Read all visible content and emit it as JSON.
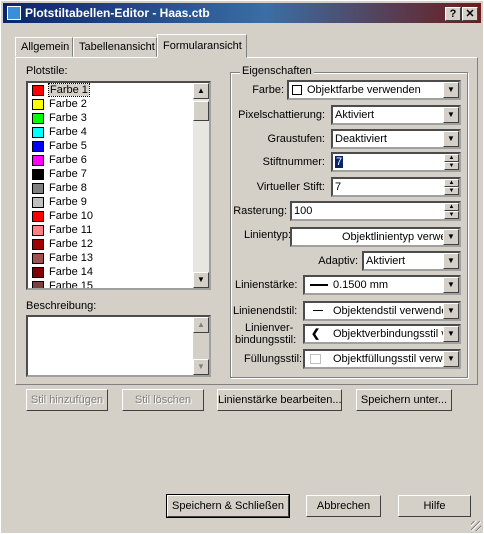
{
  "window": {
    "title": "Plotstiltabellen-Editor - Haas.ctb",
    "help_btn": "?",
    "close_btn": "✕"
  },
  "tabs": [
    {
      "label": "Allgemein"
    },
    {
      "label": "Tabellenansicht"
    },
    {
      "label": "Formularansicht"
    }
  ],
  "left": {
    "styles_label": "Plotstile:",
    "styles": [
      {
        "label": "Farbe 1",
        "color": "#ff0000"
      },
      {
        "label": "Farbe 2",
        "color": "#ffff00"
      },
      {
        "label": "Farbe 3",
        "color": "#00ff00"
      },
      {
        "label": "Farbe 4",
        "color": "#00ffff"
      },
      {
        "label": "Farbe 5",
        "color": "#0000ff"
      },
      {
        "label": "Farbe 6",
        "color": "#ff00ff"
      },
      {
        "label": "Farbe 7",
        "color": "#000000"
      },
      {
        "label": "Farbe 8",
        "color": "#808080"
      },
      {
        "label": "Farbe 9",
        "color": "#c0c0c0"
      },
      {
        "label": "Farbe 10",
        "color": "#ff0000"
      },
      {
        "label": "Farbe 11",
        "color": "#ff8080"
      },
      {
        "label": "Farbe 12",
        "color": "#a00000"
      },
      {
        "label": "Farbe 13",
        "color": "#a05050"
      },
      {
        "label": "Farbe 14",
        "color": "#800000"
      },
      {
        "label": "Farbe 15",
        "color": "#804040"
      }
    ],
    "description_label": "Beschreibung:"
  },
  "props": {
    "group_title": "Eigenschaften",
    "farbe_label": "Farbe:",
    "farbe_value": "Objektfarbe verwenden",
    "dithering_label": "Pixelschattierung:",
    "dithering_value": "Aktiviert",
    "grayscale_label": "Graustufen:",
    "grayscale_value": "Deaktiviert",
    "pen_label": "Stiftnummer:",
    "pen_value": "7",
    "virtual_pen_label": "Virtueller Stift:",
    "virtual_pen_value": "7",
    "screening_label": "Rasterung:",
    "screening_value": "100",
    "linetype_label": "Linientyp:",
    "linetype_value": "Objektlinientyp verwe",
    "adaptive_label": "Adaptiv:",
    "adaptive_value": "Aktiviert",
    "lineweight_label": "Linienstärke:",
    "lineweight_value": "0.1500 mm",
    "lineend_label": "Linienendstil:",
    "lineend_value": "Objektendstil verwende",
    "linejoin_label1": "Linienver-",
    "linejoin_label2": "bindungsstil:",
    "linejoin_value": "Objektverbindungsstil v",
    "fill_label": "Füllungsstil:",
    "fill_value": "Objektfüllungsstil verwe"
  },
  "actions": {
    "add_style": "Stil hinzufügen",
    "delete_style": "Stil löschen",
    "edit_lineweights": "Linienstärke bearbeiten...",
    "save_as": "Speichern unter..."
  },
  "footer": {
    "save_close": "Speichern & Schließen",
    "cancel": "Abbrechen",
    "help": "Hilfe"
  }
}
